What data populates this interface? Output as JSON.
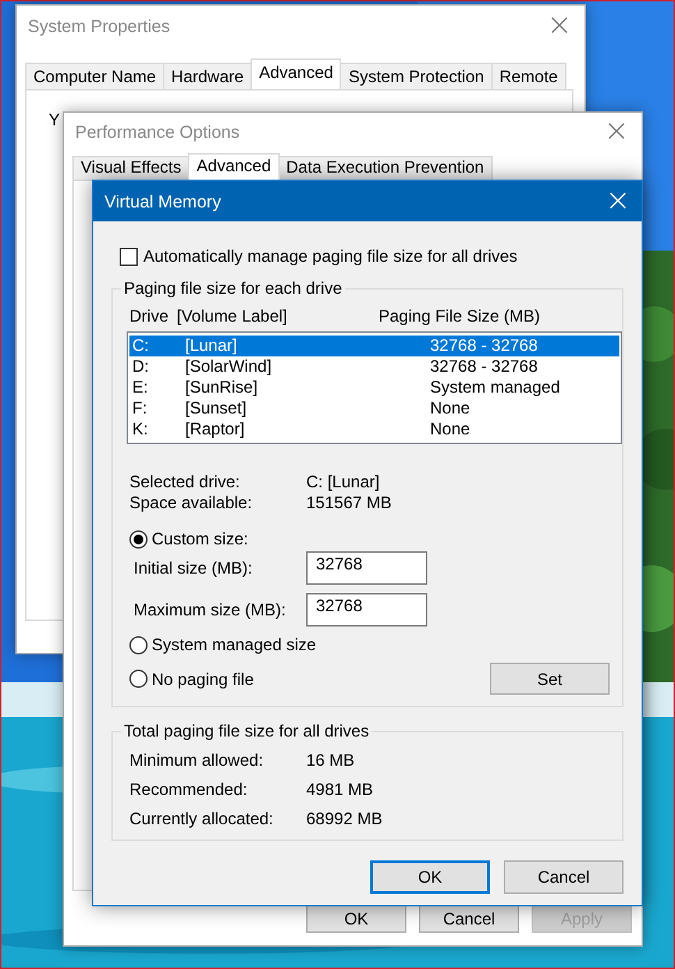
{
  "system_properties": {
    "title": "System Properties",
    "close": "×",
    "fragment": "Y",
    "tabs": [
      {
        "label": "Computer Name",
        "selected": false
      },
      {
        "label": "Hardware",
        "selected": false
      },
      {
        "label": "Advanced",
        "selected": true
      },
      {
        "label": "System Protection",
        "selected": false
      },
      {
        "label": "Remote",
        "selected": false
      }
    ]
  },
  "performance_options": {
    "title": "Performance Options",
    "close": "×",
    "tabs": [
      {
        "label": "Visual Effects",
        "selected": false
      },
      {
        "label": "Advanced",
        "selected": true
      },
      {
        "label": "Data Execution Prevention",
        "selected": false
      }
    ],
    "buttons": [
      {
        "label": "OK",
        "disabled": false
      },
      {
        "label": "Cancel",
        "disabled": false
      },
      {
        "label": "Apply",
        "disabled": true
      }
    ]
  },
  "virtual_memory": {
    "title": "Virtual Memory",
    "close": "×",
    "auto_manage": {
      "label": "Automatically manage paging file size for all drives",
      "checked": false
    },
    "paging_group": {
      "title": "Paging file size for each drive",
      "columns": [
        "Drive",
        "[Volume Label]",
        "Paging File Size (MB)"
      ],
      "drives": [
        {
          "drive": "C:",
          "label": "[Lunar]",
          "size": "32768 - 32768",
          "selected": true
        },
        {
          "drive": "D:",
          "label": "[SolarWind]",
          "size": "32768 - 32768",
          "selected": false
        },
        {
          "drive": "E:",
          "label": "[SunRise]",
          "size": "System managed",
          "selected": false
        },
        {
          "drive": "F:",
          "label": "[Sunset]",
          "size": "None",
          "selected": false
        },
        {
          "drive": "K:",
          "label": "[Raptor]",
          "size": "None",
          "selected": false
        }
      ],
      "info": [
        {
          "label": "Selected drive:",
          "value": "C:  [Lunar]"
        },
        {
          "label": "Space available:",
          "value": "151567 MB"
        }
      ],
      "options": [
        {
          "label": "Custom size:",
          "selected": true
        },
        {
          "label": "System managed size",
          "selected": false
        },
        {
          "label": "No paging file",
          "selected": false
        }
      ],
      "fields": [
        {
          "label": "Initial size (MB):",
          "value": "32768"
        },
        {
          "label": "Maximum size (MB):",
          "value": "32768"
        }
      ],
      "set_button": "Set"
    },
    "total_group": {
      "title": "Total paging file size for all drives",
      "rows": [
        {
          "label": "Minimum allowed:",
          "value": "16 MB"
        },
        {
          "label": "Recommended:",
          "value": "4981 MB"
        },
        {
          "label": "Currently allocated:",
          "value": "68992 MB"
        }
      ]
    },
    "buttons": [
      {
        "label": "OK",
        "default": true
      },
      {
        "label": "Cancel",
        "default": false
      }
    ]
  }
}
